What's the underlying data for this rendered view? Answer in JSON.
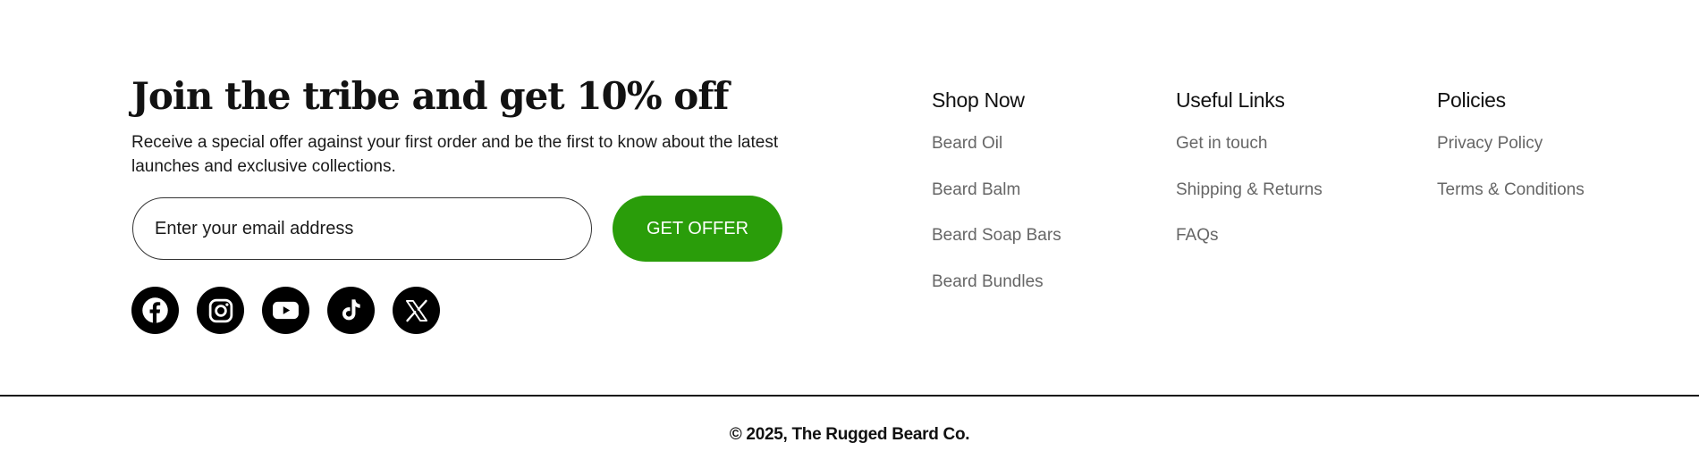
{
  "newsletter": {
    "headline": "Join the tribe and get 10% off",
    "subtext": "Receive a special offer against your first order and be the first to know about the latest launches and exclusive collections.",
    "email_placeholder": "Enter your email address",
    "button_label": "GET OFFER"
  },
  "social": [
    {
      "name": "facebook",
      "icon": "facebook-icon"
    },
    {
      "name": "instagram",
      "icon": "instagram-icon"
    },
    {
      "name": "youtube",
      "icon": "youtube-icon"
    },
    {
      "name": "tiktok",
      "icon": "tiktok-icon"
    },
    {
      "name": "x",
      "icon": "x-icon"
    }
  ],
  "columns": [
    {
      "title": "Shop Now",
      "links": [
        "Beard Oil",
        "Beard Balm",
        "Beard Soap Bars",
        "Beard Bundles"
      ]
    },
    {
      "title": "Useful Links",
      "links": [
        "Get in touch",
        "Shipping & Returns",
        "FAQs"
      ]
    },
    {
      "title": "Policies",
      "links": [
        "Privacy Policy",
        "Terms & Conditions"
      ]
    }
  ],
  "footer": {
    "copyright": "© 2025, The Rugged Beard Co."
  },
  "colors": {
    "accent": "#2a9d0a",
    "text": "#111111",
    "link": "#666666",
    "background": "#ffffff"
  }
}
